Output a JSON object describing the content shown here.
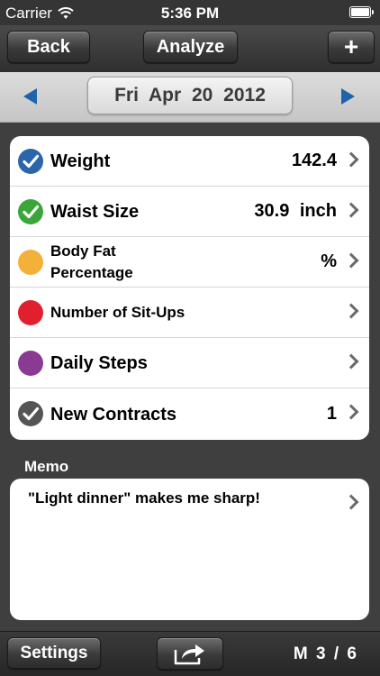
{
  "status_bar": {
    "carrier": "Carrier",
    "time": "5:36 PM"
  },
  "nav": {
    "back_label": "Back",
    "analyze_label": "Analyze",
    "add_label": "+"
  },
  "date_bar": {
    "date": "Fri Apr 20 2012"
  },
  "items": [
    {
      "label": "Weight",
      "value": "142.4",
      "icon": "check-circle-icon",
      "color": "#2a66a9"
    },
    {
      "label": "Waist Size",
      "value": "30.9 inch",
      "icon": "check-circle-icon",
      "color": "#3aa63a"
    },
    {
      "label": "Body Fat Percentage",
      "value": "%",
      "icon": "circle-icon",
      "color": "#f4b13a"
    },
    {
      "label": "Number of Sit-Ups",
      "value": "",
      "icon": "circle-icon",
      "color": "#e0202f"
    },
    {
      "label": "Daily Steps",
      "value": "",
      "icon": "circle-icon",
      "color": "#8a3a93"
    },
    {
      "label": "New Contracts",
      "value": "1",
      "icon": "check-circle-icon",
      "color": "#555555"
    }
  ],
  "memo": {
    "label": "Memo",
    "text": "\"Light dinner\" makes me sharp!"
  },
  "toolbar": {
    "settings_label": "Settings",
    "share_icon": "share-icon",
    "page_indicator": "M 3 / 6"
  }
}
